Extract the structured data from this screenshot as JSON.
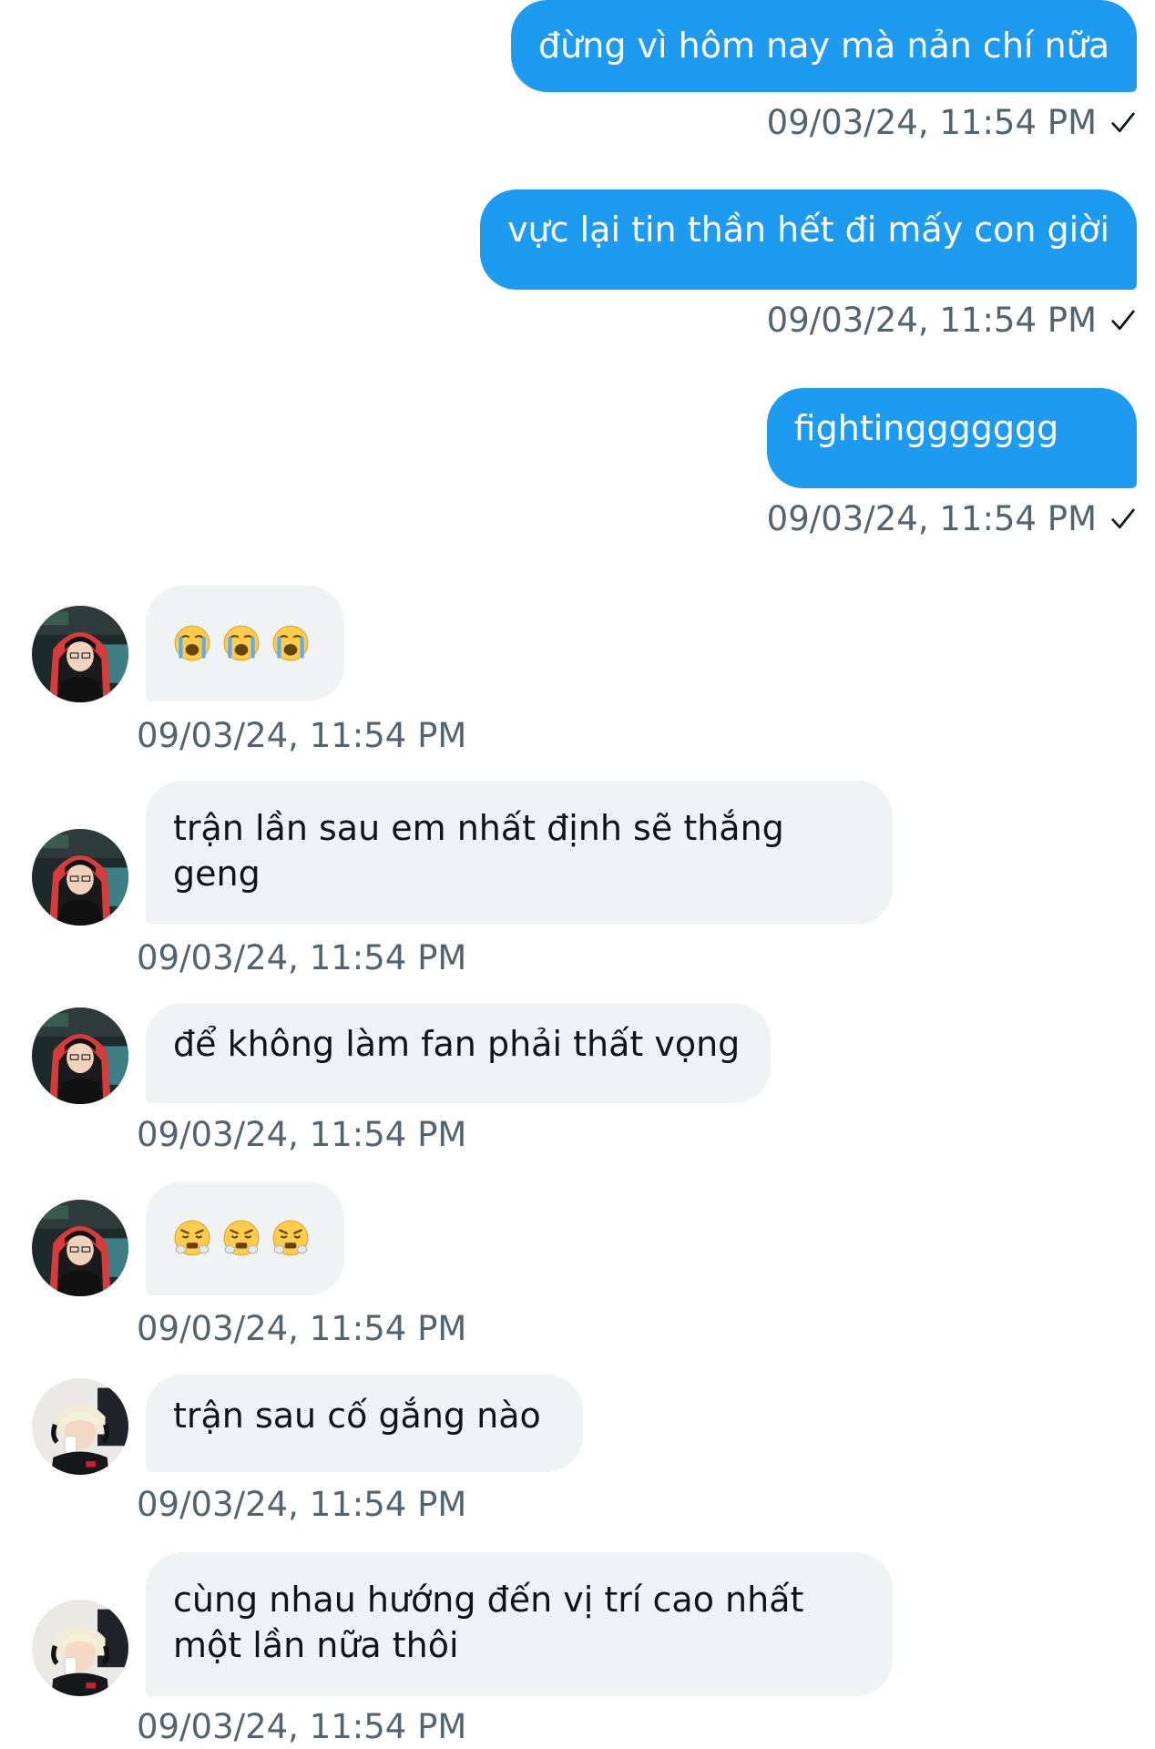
{
  "colors": {
    "outgoing_bubble": "#1d9bf0",
    "incoming_bubble": "#eff3f4",
    "timestamp_text": "#536471",
    "message_text": "#0f1419"
  },
  "messages": [
    {
      "direction": "outgoing",
      "text": "đừng vì hôm nay mà nản chí nữa",
      "timestamp": "09/03/24, 11:54 PM",
      "status_icon": "check-icon"
    },
    {
      "direction": "outgoing",
      "text": "vực lại tin thần hết đi mấy con giời",
      "timestamp": "09/03/24, 11:54 PM",
      "status_icon": "check-icon"
    },
    {
      "direction": "outgoing",
      "text": "fightinggggggg",
      "timestamp": "09/03/24, 11:54 PM",
      "status_icon": "check-icon"
    },
    {
      "direction": "incoming",
      "sender_avatar": "avatar-1",
      "emoji": [
        "loudly-crying-face",
        "loudly-crying-face",
        "loudly-crying-face"
      ],
      "timestamp": "09/03/24, 11:54 PM"
    },
    {
      "direction": "incoming",
      "sender_avatar": "avatar-1",
      "text": "trận lần sau em nhất định sẽ thắng geng",
      "timestamp": "09/03/24, 11:54 PM"
    },
    {
      "direction": "incoming",
      "sender_avatar": "avatar-1",
      "text": "để không làm fan phải thất vọng",
      "timestamp": "09/03/24, 11:54 PM"
    },
    {
      "direction": "incoming",
      "sender_avatar": "avatar-1",
      "emoji": [
        "face-with-steam-from-nose",
        "face-with-steam-from-nose",
        "face-with-steam-from-nose"
      ],
      "timestamp": "09/03/24, 11:54 PM"
    },
    {
      "direction": "incoming",
      "sender_avatar": "avatar-2",
      "text": "trận sau cố gắng nào",
      "timestamp": "09/03/24, 11:54 PM"
    },
    {
      "direction": "incoming",
      "sender_avatar": "avatar-2",
      "text": "cùng nhau hướng đến vị trí cao nhất một lần nữa thôi",
      "timestamp": "09/03/24, 11:54 PM"
    }
  ]
}
